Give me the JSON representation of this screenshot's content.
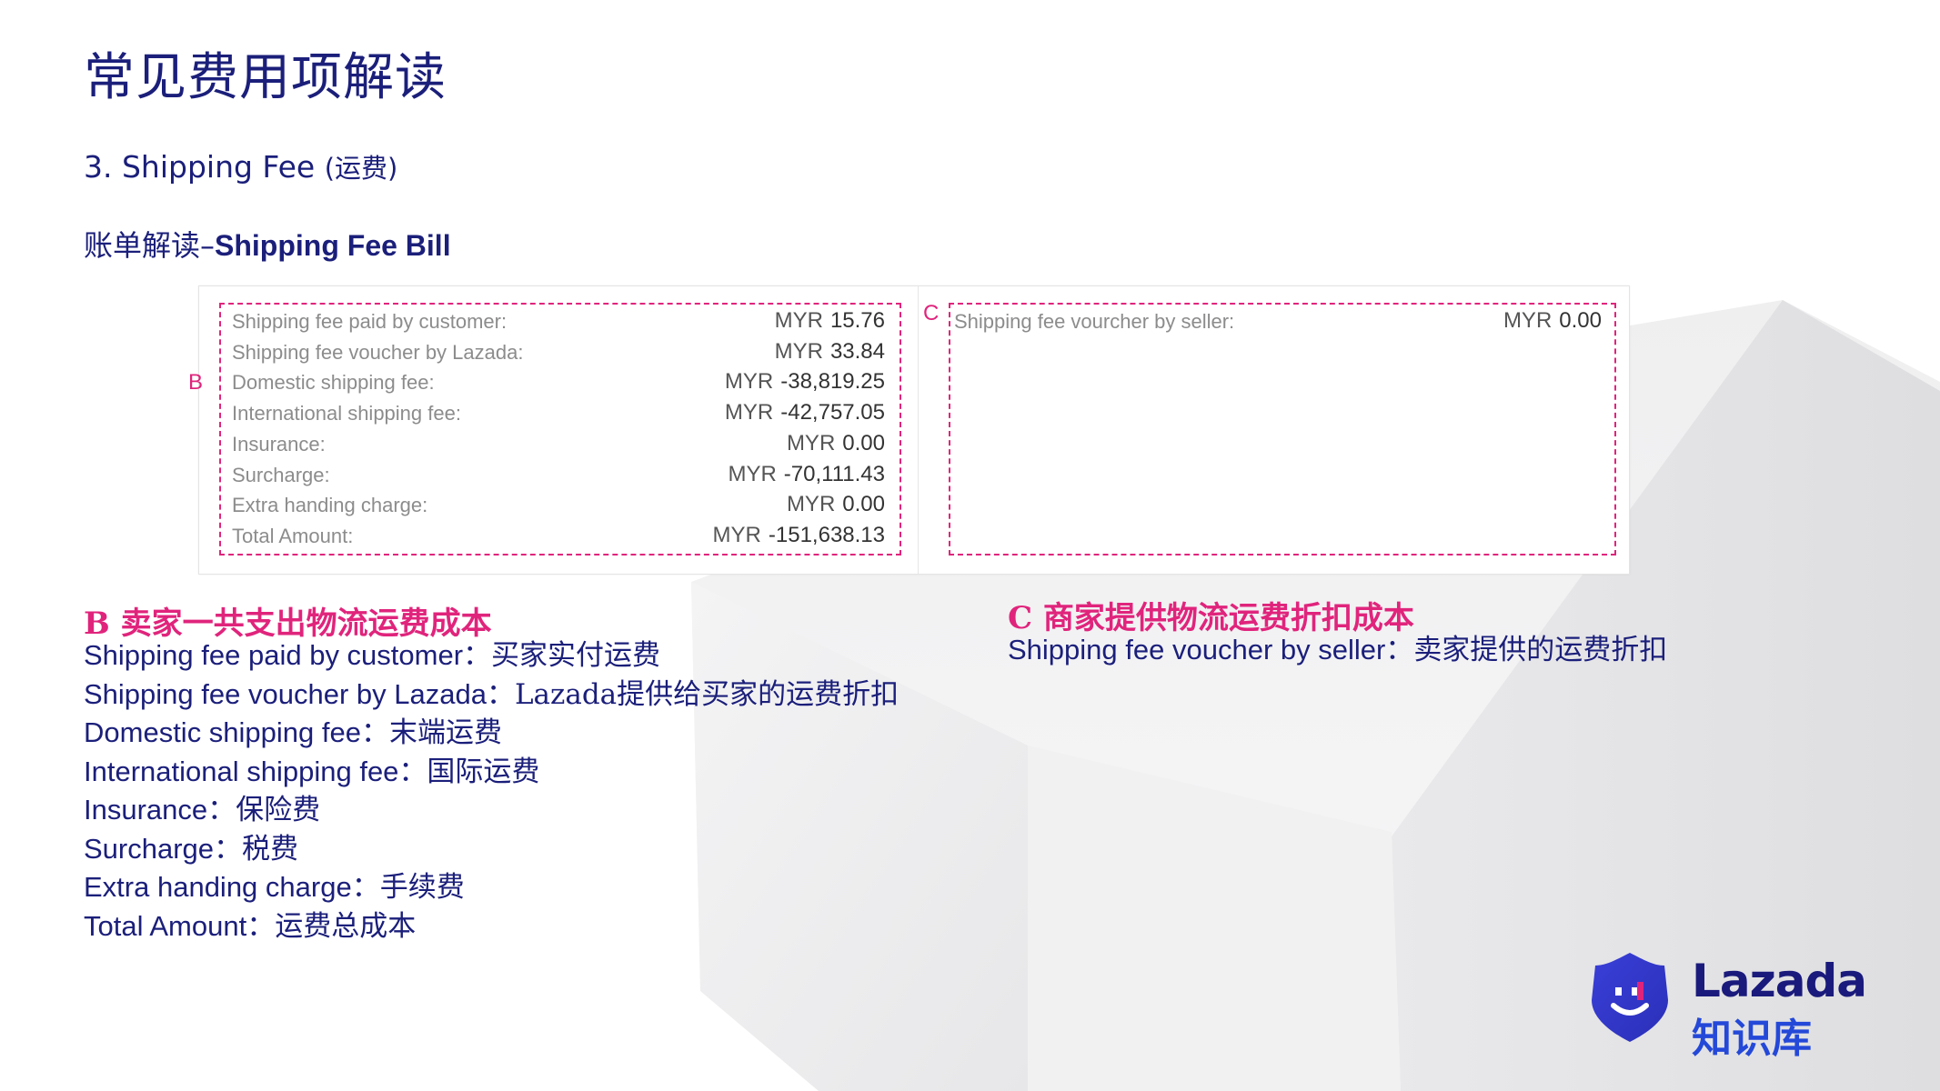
{
  "page": {
    "title": "常见费用项解读",
    "section": {
      "number_label": "3. Shipping Fee",
      "paren_label": "(运费)"
    },
    "bill_heading": {
      "zh": "账单解读–",
      "en": "Shipping Fee Bill"
    }
  },
  "bill": {
    "box_b_letter": "B",
    "box_c_letter": "C",
    "box_b_rows": [
      {
        "label": "Shipping fee paid by customer:",
        "currency": "MYR",
        "amount": "15.76"
      },
      {
        "label": "Shipping fee voucher by Lazada:",
        "currency": "MYR",
        "amount": "33.84"
      },
      {
        "label": "Domestic shipping fee:",
        "currency": "MYR",
        "amount": "-38,819.25"
      },
      {
        "label": "International shipping fee:",
        "currency": "MYR",
        "amount": "-42,757.05"
      },
      {
        "label": "Insurance:",
        "currency": "MYR",
        "amount": "0.00"
      },
      {
        "label": "Surcharge:",
        "currency": "MYR",
        "amount": "-70,111.43"
      },
      {
        "label": "Extra handing charge:",
        "currency": "MYR",
        "amount": "0.00"
      },
      {
        "label": "Total Amount:",
        "currency": "MYR",
        "amount": "-151,638.13"
      }
    ],
    "box_c_rows": [
      {
        "label": "Shipping fee vourcher by seller:",
        "currency": "MYR",
        "amount": "0.00"
      }
    ]
  },
  "explanations": {
    "b": {
      "heading": "B 卖家一共支出物流运费成本",
      "items": [
        {
          "en": "Shipping fee paid by customer：",
          "zh": "买家实付运费"
        },
        {
          "en": "Shipping fee voucher by Lazada：",
          "zh": "Lazada提供给买家的运费折扣"
        },
        {
          "en": "Domestic shipping fee：",
          "zh": "末端运费"
        },
        {
          "en": "International shipping fee：",
          "zh": "国际运费"
        },
        {
          "en": "Insurance：",
          "zh": "保险费"
        },
        {
          "en": "Surcharge：",
          "zh": "税费"
        },
        {
          "en": "Extra handing charge：",
          "zh": "手续费"
        },
        {
          "en": "Total Amount：",
          "zh": "运费总成本"
        }
      ]
    },
    "c": {
      "heading": "C 商家提供物流运费折扣成本",
      "items": [
        {
          "en": "Shipping fee voucher by seller：",
          "zh": "卖家提供的运费折扣"
        }
      ]
    }
  },
  "logo": {
    "name": "Lazada",
    "sub": "知识库",
    "icon": "lazada-heart-bag-icon"
  },
  "colors": {
    "title": "#1b1f7a",
    "accent_pink": "#e0247c",
    "logo_blue": "#2448d8"
  }
}
